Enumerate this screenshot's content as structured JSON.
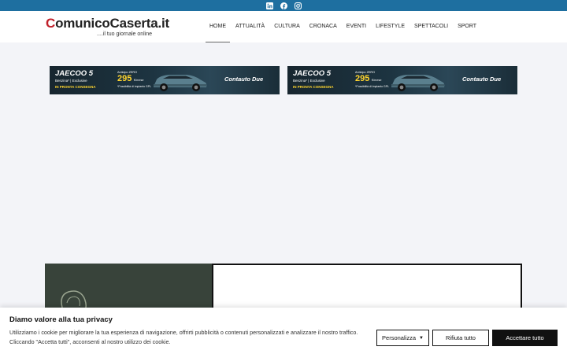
{
  "social": {
    "icons": [
      "linkedin-icon",
      "facebook-icon",
      "instagram-icon"
    ]
  },
  "logo": {
    "initial": "C",
    "name_rest": "omunicoCaserta.it",
    "tagline": "....il tuo giornale online"
  },
  "nav": {
    "items": [
      "HOME",
      "ATTUALITÀ",
      "CULTURA",
      "CRONACA",
      "EVENTI",
      "LIFESTYLE",
      "SPETTACOLI",
      "SPORT"
    ],
    "active": "HOME"
  },
  "ads": [
    {
      "brand": "JAECOO 5",
      "subtitle": "Benzina* | Exclusive",
      "consegna": "IN PRONTA CONSEGNA",
      "anticipo": "Anticipo ZERO",
      "price": "295",
      "per_month": "€/mese",
      "gpl": "*Possibilità di impianto GPL",
      "dealer": "Contauto Due"
    },
    {
      "brand": "JAECOO 5",
      "subtitle": "Benzina* | Exclusive",
      "consegna": "IN PRONTA CONSEGNA",
      "anticipo": "Anticipo ZERO",
      "price": "295",
      "per_month": "€/mese",
      "gpl": "*Possibilità di impianto GPL",
      "dealer": "Contauto Due"
    }
  ],
  "cookie": {
    "title": "Diamo valore alla tua privacy",
    "text": "Utilizziamo i cookie per migliorare la tua esperienza di navigazione, offrirti pubblicità o contenuti personalizzati e analizzare il nostro traffico. Cliccando \"Accetta tutti\", acconsenti al nostro utilizzo dei cookie.",
    "customize": "Personalizza",
    "reject": "Rifiuta tutto",
    "accept": "Accettare tutto"
  },
  "colors": {
    "topbar": "#1e6fa0",
    "logo_initial": "#c0202a",
    "ad_highlight": "#ffd52e"
  }
}
